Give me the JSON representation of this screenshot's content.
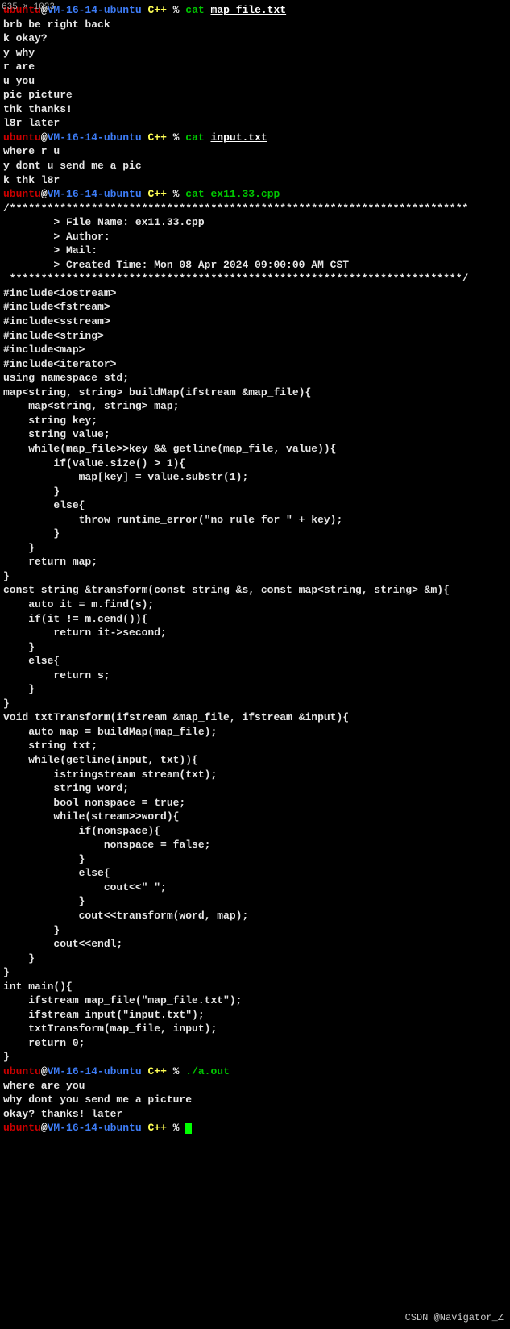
{
  "dim_label": "635 × 1023",
  "prompt": {
    "user": "ubuntu",
    "at": "@",
    "host": "VM-16-14-ubuntu",
    "path_sep": " ",
    "path": "C++",
    "marker": " % "
  },
  "blocks": [
    {
      "cmd": "cat",
      "arg": "map_file.txt",
      "arg_class": "arg",
      "output": [
        "brb be right back",
        "k okay?",
        "y why",
        "r are",
        "u you",
        "pic picture",
        "thk thanks!",
        "l8r later"
      ]
    },
    {
      "cmd": "cat",
      "arg": "input.txt",
      "arg_class": "arg",
      "output": [
        "where r u",
        "y dont u send me a pic",
        "k thk l8r"
      ]
    },
    {
      "cmd": "cat",
      "arg": "ex11.33.cpp",
      "arg_class": "arg2",
      "output": [
        "/*************************************************************************",
        "        > File Name: ex11.33.cpp",
        "        > Author:",
        "        > Mail:",
        "        > Created Time: Mon 08 Apr 2024 09:00:00 AM CST",
        " ************************************************************************/",
        "",
        "#include<iostream>",
        "#include<fstream>",
        "#include<sstream>",
        "#include<string>",
        "#include<map>",
        "#include<iterator>",
        "using namespace std;",
        "",
        "map<string, string> buildMap(ifstream &map_file){",
        "    map<string, string> map;",
        "    string key;",
        "    string value;",
        "    while(map_file>>key && getline(map_file, value)){",
        "        if(value.size() > 1){",
        "            map[key] = value.substr(1);",
        "        }",
        "        else{",
        "            throw runtime_error(\"no rule for \" + key);",
        "        }",
        "    }",
        "    return map;",
        "}",
        "",
        "const string &transform(const string &s, const map<string, string> &m){",
        "    auto it = m.find(s);",
        "    if(it != m.cend()){",
        "        return it->second;",
        "    }",
        "    else{",
        "        return s;",
        "    }",
        "}",
        "",
        "void txtTransform(ifstream &map_file, ifstream &input){",
        "    auto map = buildMap(map_file);",
        "    string txt;",
        "    while(getline(input, txt)){",
        "        istringstream stream(txt);",
        "        string word;",
        "        bool nonspace = true;",
        "        while(stream>>word){",
        "            if(nonspace){",
        "                nonspace = false;",
        "            }",
        "            else{",
        "                cout<<\" \";",
        "            }",
        "            cout<<transform(word, map);",
        "        }",
        "        cout<<endl;",
        "    }",
        "}",
        "",
        "int main(){",
        "    ifstream map_file(\"map_file.txt\");",
        "    ifstream input(\"input.txt\");",
        "    txtTransform(map_file, input);",
        "",
        "    return 0;",
        "}"
      ]
    },
    {
      "cmd": "",
      "run": "./a.out",
      "output": [
        "where are you",
        "why dont you send me a picture",
        "okay? thanks! later"
      ]
    }
  ],
  "watermark": "CSDN @Navigator_Z"
}
